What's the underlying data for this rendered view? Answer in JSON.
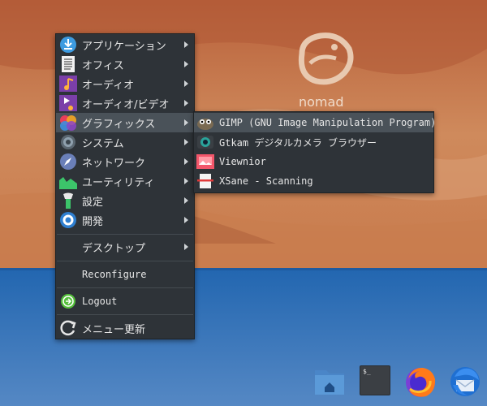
{
  "desktop": {
    "logo_text": "nomad"
  },
  "main_menu": {
    "items": [
      {
        "label": "アプリケーション",
        "icon": "download-icon"
      },
      {
        "label": "オフィス",
        "icon": "document-icon"
      },
      {
        "label": "オーディオ",
        "icon": "audio-icon"
      },
      {
        "label": "オーディオ/ビデオ",
        "icon": "audio-video-icon"
      },
      {
        "label": "グラフィックス",
        "icon": "graphics-icon"
      },
      {
        "label": "システム",
        "icon": "system-gear-icon"
      },
      {
        "label": "ネットワーク",
        "icon": "network-compass-icon"
      },
      {
        "label": "ユーティリティ",
        "icon": "utilities-icon"
      },
      {
        "label": "設定",
        "icon": "settings-wrench-icon"
      },
      {
        "label": "開発",
        "icon": "development-gear-icon"
      }
    ],
    "desktop_label": "デスクトップ",
    "reconfigure_label": "Reconfigure",
    "logout_label": "Logout",
    "refresh_label": "メニュー更新"
  },
  "graphics_submenu": {
    "items": [
      {
        "label": "GIMP (GNU Image Manipulation Program)",
        "icon": "gimp-icon"
      },
      {
        "label": "Gtkam デジタルカメラ ブラウザー",
        "icon": "camera-icon"
      },
      {
        "label": "Viewnior",
        "icon": "image-viewer-icon"
      },
      {
        "label": "XSane - Scanning",
        "icon": "scanner-icon"
      }
    ]
  },
  "dock": {
    "items": [
      {
        "name": "home-folder-icon"
      },
      {
        "name": "terminal-icon",
        "text": "$_"
      },
      {
        "name": "firefox-icon"
      },
      {
        "name": "thunderbird-icon"
      }
    ]
  },
  "colors": {
    "menu_bg": "#2e3338",
    "menu_highlight": "#4a5259",
    "menu_text": "#e6e6e6"
  }
}
